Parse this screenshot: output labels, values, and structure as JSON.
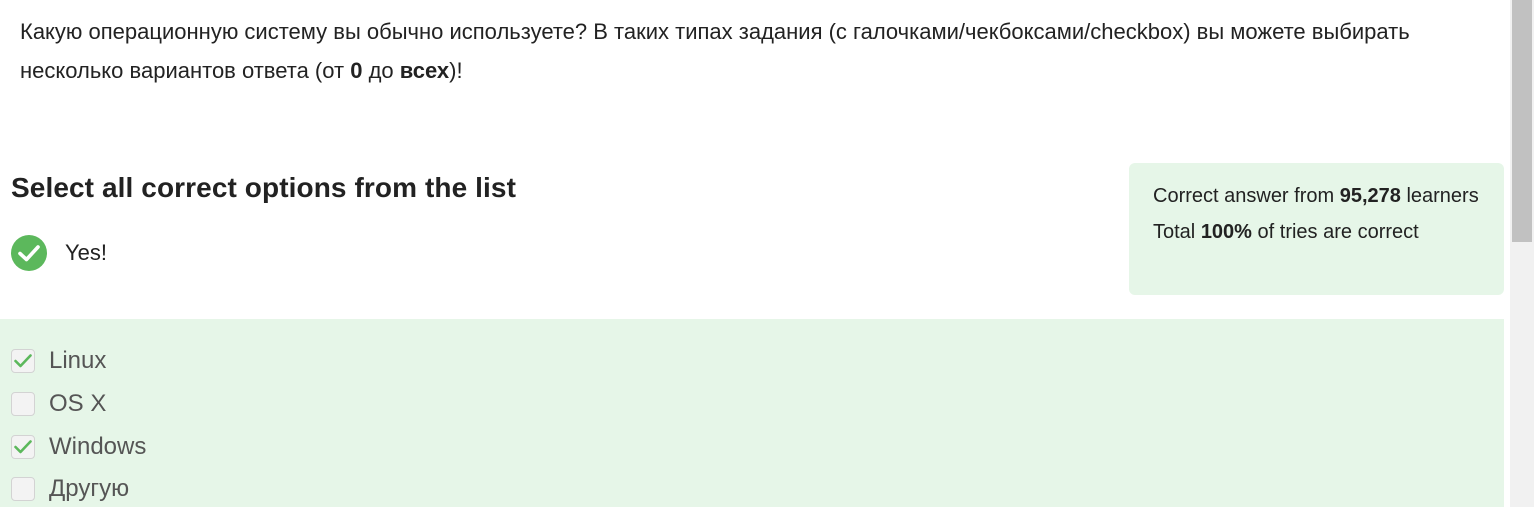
{
  "question": {
    "part1": "Какую операционную систему вы обычно используете? В таких типах задания (с галочками/чекбоксами/checkbox) вы можете выбирать несколько вариантов ответа (от ",
    "bold1": "0",
    "part2": " до ",
    "bold2": "всех",
    "part3": ")!"
  },
  "quiz": {
    "title": "Select all correct options from the list",
    "feedback": "Yes!"
  },
  "stats": {
    "line1_prefix": "Correct answer from ",
    "learners": "95,278",
    "line1_suffix": " learners",
    "line2_prefix": "Total ",
    "percent": "100%",
    "line2_suffix": " of tries are correct"
  },
  "options": [
    {
      "label": "Linux",
      "checked": true
    },
    {
      "label": "OS X",
      "checked": false
    },
    {
      "label": "Windows",
      "checked": true
    },
    {
      "label": "Другую",
      "checked": false
    }
  ],
  "colors": {
    "success": "#5cb85c",
    "panel_bg": "#e6f6e8",
    "option_text": "#555555"
  },
  "icons": {
    "feedback": "check-circle-icon",
    "checkbox_checked": "checkmark-icon"
  }
}
